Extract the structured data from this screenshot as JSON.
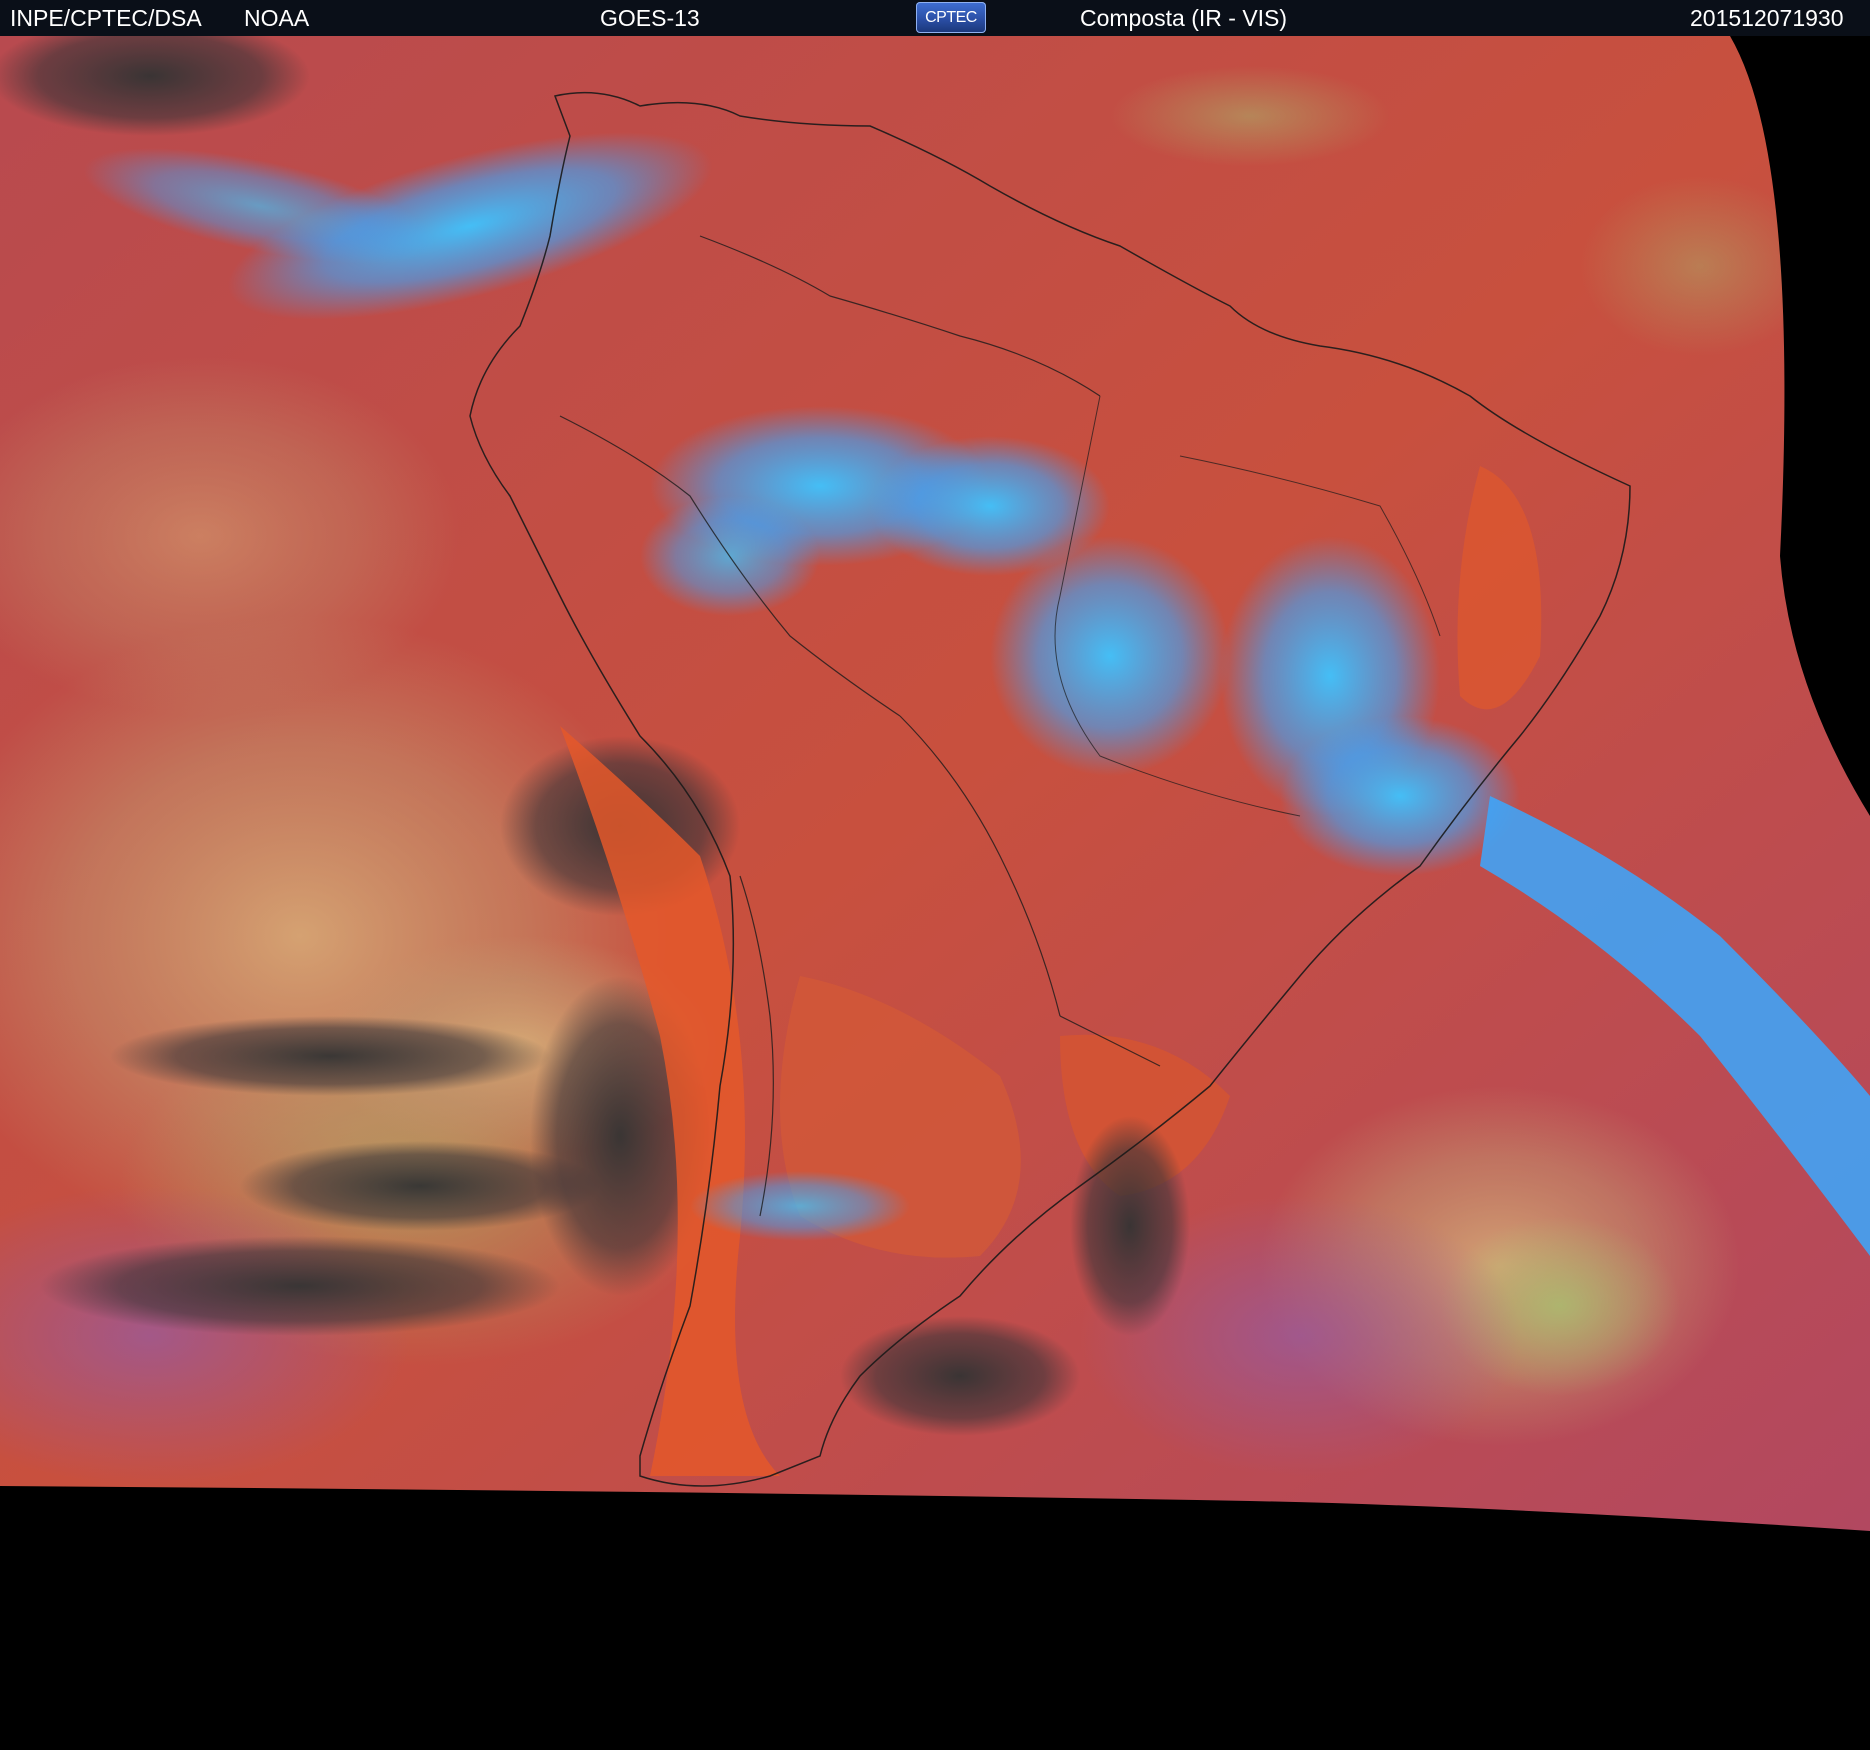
{
  "header": {
    "agency": "INPE/CPTEC/DSA",
    "provider": "NOAA",
    "satellite": "GOES-13",
    "logo_text": "CPTEC",
    "product": "Composta (IR - VIS)",
    "timestamp": "201512071930"
  },
  "colors": {
    "header_background": "#0a0f18",
    "clear_land_ocean": "#c9503f",
    "deep_convection": "#33b8ff",
    "low_cloud": "#bfa070",
    "no_data": "#000000"
  }
}
